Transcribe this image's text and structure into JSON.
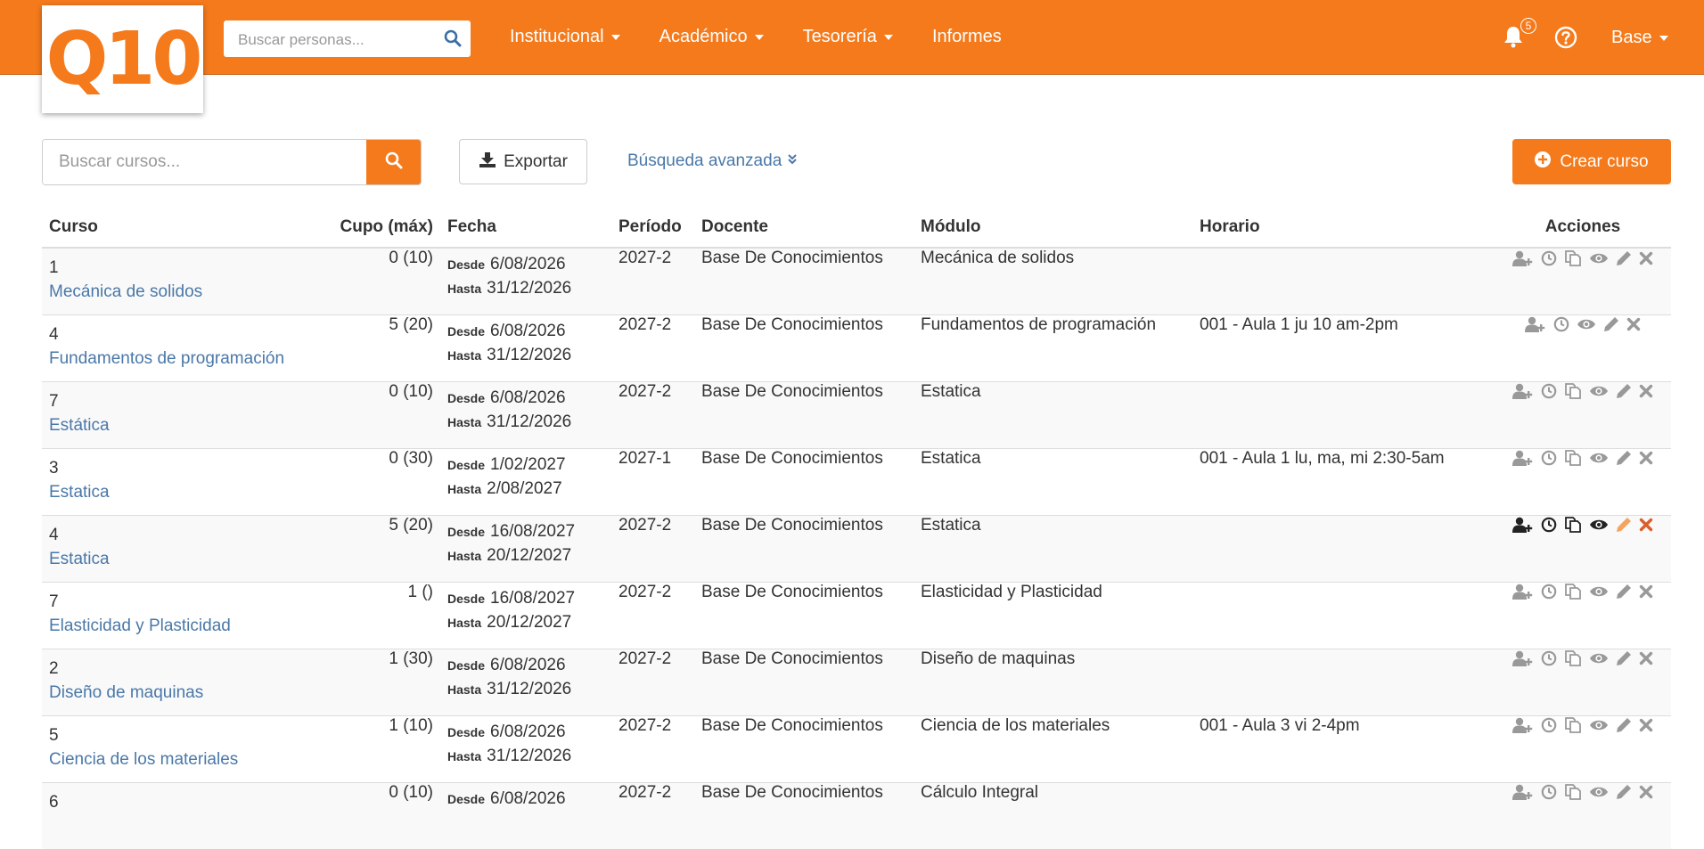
{
  "header": {
    "logo_text": "Q10",
    "search_placeholder": "Buscar personas...",
    "menu": [
      {
        "label": "Institucional",
        "has_caret": true
      },
      {
        "label": "Académico",
        "has_caret": true
      },
      {
        "label": "Tesorería",
        "has_caret": true
      },
      {
        "label": "Informes",
        "has_caret": false
      }
    ],
    "notification_count": "5",
    "user_label": "Base",
    "accent_color": "#f47a1c"
  },
  "toolbar": {
    "search_placeholder": "Buscar cursos...",
    "export_label": "Exportar",
    "advanced_search_label": "Búsqueda avanzada",
    "create_label": "Crear curso"
  },
  "table": {
    "columns": [
      "Curso",
      "Cupo (máx)",
      "Fecha",
      "Período",
      "Docente",
      "Módulo",
      "Horario",
      "Acciones"
    ],
    "date_labels": {
      "from": "Desde",
      "to": "Hasta"
    },
    "rows": [
      {
        "num": "1",
        "name": "Mecánica de solidos",
        "cupo": "0 (10)",
        "desde": "6/08/2026",
        "hasta": "31/12/2026",
        "periodo": "2027-2",
        "docente": "Base De Conocimientos",
        "modulo": "Mecánica de solidos",
        "horario": "",
        "actions": [
          "add-user-icon",
          "clock-icon",
          "copy-icon",
          "eye-icon",
          "pencil-icon",
          "delete-icon"
        ]
      },
      {
        "num": "4",
        "name": "Fundamentos de programación",
        "cupo": "5 (20)",
        "desde": "6/08/2026",
        "hasta": "31/12/2026",
        "periodo": "2027-2",
        "docente": "Base De Conocimientos",
        "modulo": "Fundamentos de programación",
        "horario": "001 - Aula 1 ju 10 am-2pm",
        "actions": [
          "add-user-icon",
          "clock-icon",
          "eye-icon",
          "pencil-icon",
          "delete-icon"
        ]
      },
      {
        "num": "7",
        "name": "Estática",
        "cupo": "0 (10)",
        "desde": "6/08/2026",
        "hasta": "31/12/2026",
        "periodo": "2027-2",
        "docente": "Base De Conocimientos",
        "modulo": "Estatica",
        "horario": "",
        "actions": [
          "add-user-icon",
          "clock-icon",
          "copy-icon",
          "eye-icon",
          "pencil-icon",
          "delete-icon"
        ]
      },
      {
        "num": "3",
        "name": "Estatica",
        "cupo": "0 (30)",
        "desde": "1/02/2027",
        "hasta": "2/08/2027",
        "periodo": "2027-1",
        "docente": "Base De Conocimientos",
        "modulo": "Estatica",
        "horario": "001 - Aula 1 lu, ma, mi 2:30-5am",
        "actions": [
          "add-user-icon",
          "clock-icon",
          "copy-icon",
          "eye-icon",
          "pencil-icon",
          "delete-icon"
        ]
      },
      {
        "num": "4",
        "name": "Estatica",
        "cupo": "5 (20)",
        "desde": "16/08/2027",
        "hasta": "20/12/2027",
        "periodo": "2027-2",
        "docente": "Base De Conocimientos",
        "modulo": "Estatica",
        "horario": "",
        "highlighted": true,
        "actions": [
          "add-user-icon",
          "clock-icon",
          "copy-icon",
          "eye-icon",
          "pencil-icon",
          "delete-icon"
        ]
      },
      {
        "num": "7",
        "name": "Elasticidad y Plasticidad",
        "cupo": "1 ()",
        "desde": "16/08/2027",
        "hasta": "20/12/2027",
        "periodo": "2027-2",
        "docente": "Base De Conocimientos",
        "modulo": "Elasticidad y Plasticidad",
        "horario": "",
        "actions": [
          "add-user-icon",
          "clock-icon",
          "copy-icon",
          "eye-icon",
          "pencil-icon",
          "delete-icon"
        ]
      },
      {
        "num": "2",
        "name": "Diseño de maquinas",
        "cupo": "1 (30)",
        "desde": "6/08/2026",
        "hasta": "31/12/2026",
        "periodo": "2027-2",
        "docente": "Base De Conocimientos",
        "modulo": "Diseño de maquinas",
        "horario": "",
        "actions": [
          "add-user-icon",
          "clock-icon",
          "copy-icon",
          "eye-icon",
          "pencil-icon",
          "delete-icon"
        ]
      },
      {
        "num": "5",
        "name": "Ciencia de los materiales",
        "cupo": "1 (10)",
        "desde": "6/08/2026",
        "hasta": "31/12/2026",
        "periodo": "2027-2",
        "docente": "Base De Conocimientos",
        "modulo": "Ciencia de los materiales",
        "horario": "001 - Aula 3 vi 2-4pm",
        "actions": [
          "add-user-icon",
          "clock-icon",
          "copy-icon",
          "eye-icon",
          "pencil-icon",
          "delete-icon"
        ]
      },
      {
        "num": "6",
        "name": "",
        "cupo": "0 (10)",
        "desde": "6/08/2026",
        "hasta": "",
        "periodo": "2027-2",
        "docente": "Base De Conocimientos",
        "modulo": "Cálculo Integral",
        "horario": "",
        "actions": [
          "add-user-icon",
          "clock-icon",
          "copy-icon",
          "eye-icon",
          "pencil-icon",
          "delete-icon"
        ]
      }
    ]
  }
}
